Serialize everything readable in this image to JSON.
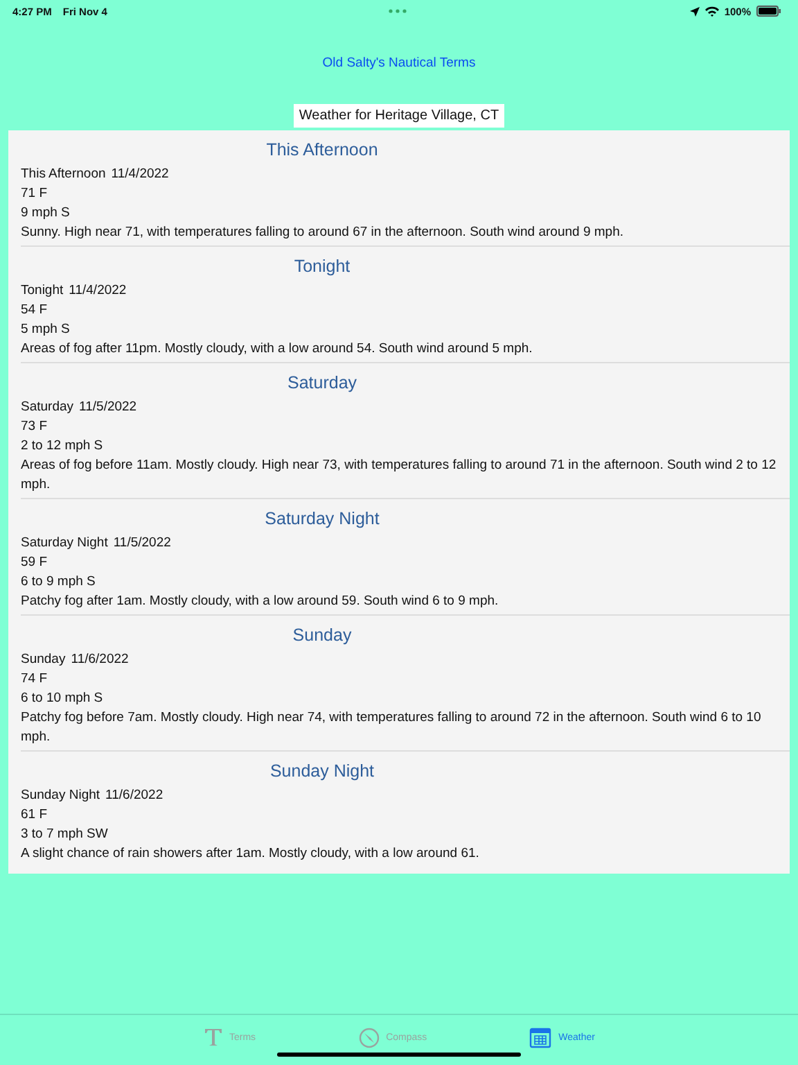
{
  "status_bar": {
    "time": "4:27 PM",
    "date": "Fri Nov 4",
    "battery": "100%"
  },
  "app_title": "Old Salty's Nautical Terms",
  "location_label": "Weather for Heritage Village, CT",
  "forecasts": [
    {
      "heading": "This Afternoon",
      "name": "This Afternoon",
      "date": "11/4/2022",
      "temperature": "71 F",
      "wind": "9 mph S",
      "detail": "Sunny. High near 71, with temperatures falling to around 67 in the afternoon. South wind around 9 mph."
    },
    {
      "heading": "Tonight",
      "name": "Tonight",
      "date": "11/4/2022",
      "temperature": "54 F",
      "wind": "5 mph S",
      "detail": "Areas of fog after 11pm. Mostly cloudy, with a low around 54. South wind around 5 mph."
    },
    {
      "heading": "Saturday",
      "name": "Saturday",
      "date": "11/5/2022",
      "temperature": "73 F",
      "wind": "2 to 12 mph S",
      "detail": "Areas of fog before 11am. Mostly cloudy. High near 73, with temperatures falling to around 71 in the afternoon. South wind 2 to 12 mph."
    },
    {
      "heading": "Saturday Night",
      "name": "Saturday Night",
      "date": "11/5/2022",
      "temperature": "59 F",
      "wind": "6 to 9 mph S",
      "detail": "Patchy fog after 1am. Mostly cloudy, with a low around 59. South wind 6 to 9 mph."
    },
    {
      "heading": "Sunday",
      "name": "Sunday",
      "date": "11/6/2022",
      "temperature": "74 F",
      "wind": "6 to 10 mph S",
      "detail": "Patchy fog before 7am. Mostly cloudy. High near 74, with temperatures falling to around 72 in the afternoon. South wind 6 to 10 mph."
    },
    {
      "heading": "Sunday Night",
      "name": "Sunday Night",
      "date": "11/6/2022",
      "temperature": "61 F",
      "wind": "3 to 7 mph SW",
      "detail": "A slight chance of rain showers after 1am. Mostly cloudy, with a low around 61."
    }
  ],
  "tabs": [
    {
      "label": "Terms",
      "kind": "terms",
      "selected": false
    },
    {
      "label": "Compass",
      "kind": "compass",
      "selected": false
    },
    {
      "label": "Weather",
      "kind": "weather",
      "selected": true
    }
  ]
}
